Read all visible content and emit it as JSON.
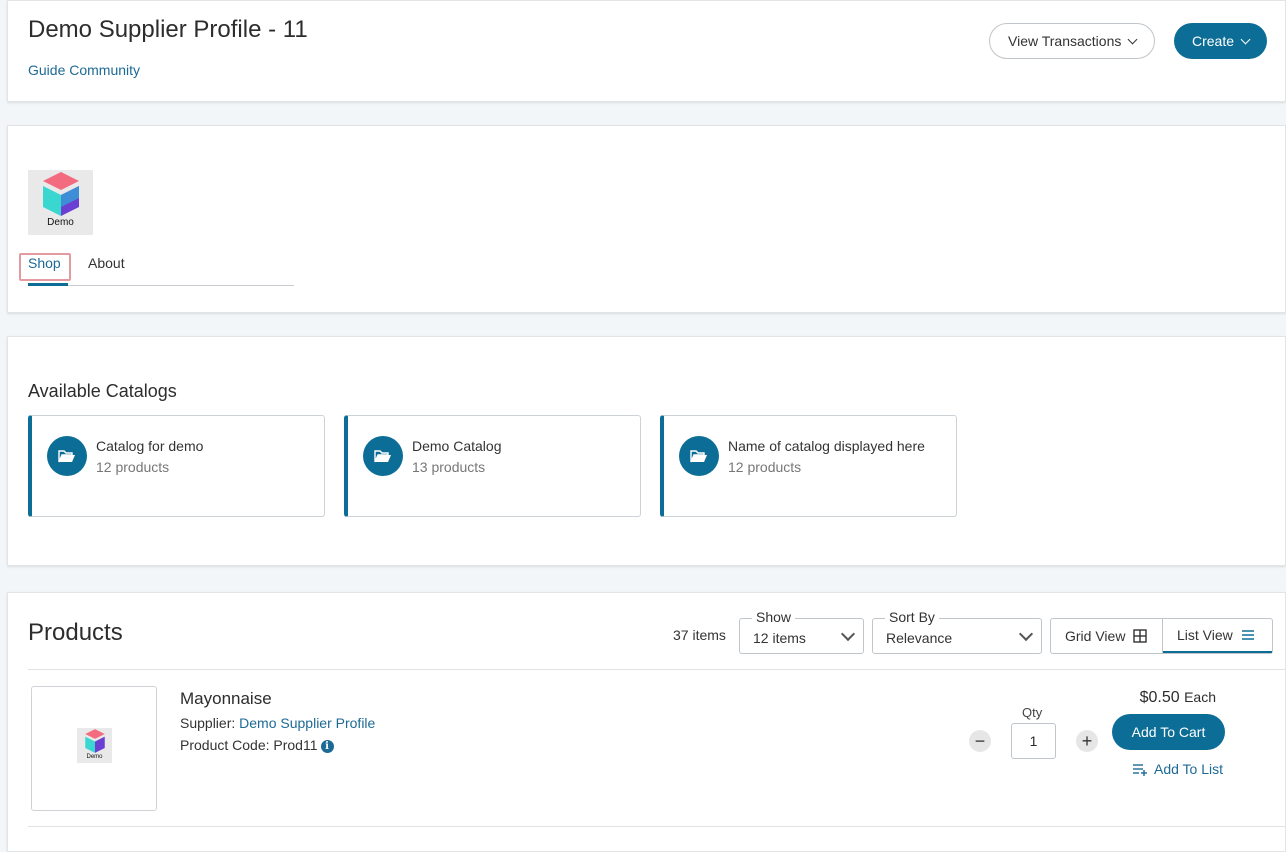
{
  "header": {
    "title": "Demo Supplier Profile - 11",
    "subtitle_link": "Guide Community",
    "view_transactions_label": "View Transactions",
    "create_label": "Create"
  },
  "brand": {
    "logo_text": "Demo",
    "tabs": [
      {
        "label": "Shop",
        "active": true
      },
      {
        "label": "About",
        "active": false
      }
    ]
  },
  "catalogs": {
    "heading": "Available Catalogs",
    "items": [
      {
        "name": "Catalog for demo",
        "count": "12 products",
        "icon": "folder-open-icon"
      },
      {
        "name": "Demo Catalog",
        "count": "13 products",
        "icon": "folder-open-icon"
      },
      {
        "name": "Name of catalog displayed here",
        "count": "12 products",
        "icon": "folder-open-icon"
      }
    ]
  },
  "products": {
    "heading": "Products",
    "count": "37 items",
    "show": {
      "legend": "Show",
      "value": "12 items"
    },
    "sort": {
      "legend": "Sort By",
      "value": "Relevance"
    },
    "grid_view_label": "Grid View",
    "list_view_label": "List View",
    "items": [
      {
        "name": "Mayonnaise",
        "supplier_label": "Supplier:",
        "supplier_name": "Demo Supplier Profile",
        "code_label": "Product Code:",
        "code": "Prod11",
        "thumb_text": "Demo",
        "qty_label": "Qty",
        "qty": "1",
        "price": "$0.50",
        "unit": "Each",
        "add_to_cart_label": "Add To Cart",
        "add_to_list_label": "Add To List"
      }
    ]
  },
  "colors": {
    "primary": "#0c6e96",
    "link": "#1d6a96",
    "focus_outline": "#e39aa0",
    "logo_pink": "#f36b7f",
    "logo_teal": "#3ad6d0",
    "logo_purple": "#6b3fd1"
  }
}
